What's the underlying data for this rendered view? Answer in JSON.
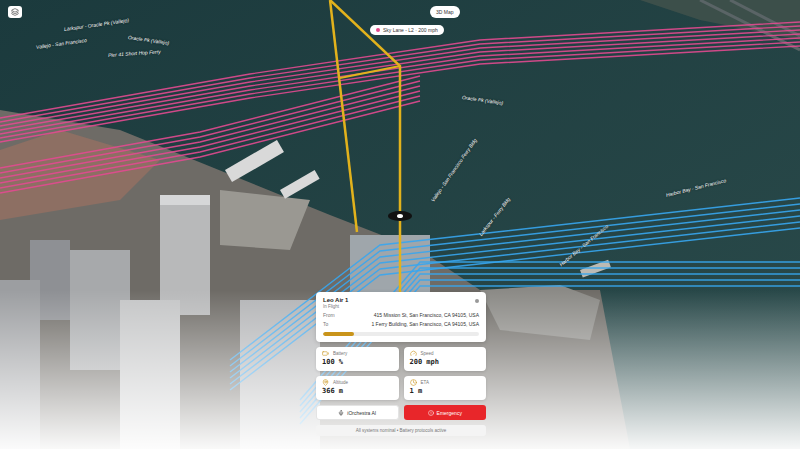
{
  "map": {
    "mode_button": "3D Map",
    "lane_tooltip": "Sky Lane - L2 · 200 mph",
    "labels": [
      "Larkspur - Oracle Pk (Vallejo)",
      "Vallejo - San Francisco",
      "Oracle Pk (Vallejo)",
      "Pier 41 Short Hop Ferry",
      "Oracle Pk (Vallejo)",
      "Harbor Bay - San Francisco",
      "Vallejo - San Francisco Ferry Bldg",
      "Larkspur - Ferry Bldg",
      "Harbor Bay - San Francisco"
    ]
  },
  "flight": {
    "name": "Leo Air 1",
    "status": "In Flight",
    "from_label": "From",
    "from": "415 Mission St, San Francisco, CA 94105, USA",
    "to_label": "To",
    "to": "1 Ferry Building, San Francisco, CA 94105, USA",
    "progress": 0.2
  },
  "stats": [
    {
      "label": "Battery",
      "value": "100 %"
    },
    {
      "label": "Speed",
      "value": "200 mph"
    },
    {
      "label": "Altitude",
      "value": "366 m"
    },
    {
      "label": "ETA",
      "value": "1 m"
    }
  ],
  "actions": [
    {
      "label": "iOrchestra AI",
      "kind": "assistant"
    },
    {
      "label": "Emergency",
      "kind": "danger"
    }
  ],
  "status_bar": "All systems nominal • Battery protocols active"
}
